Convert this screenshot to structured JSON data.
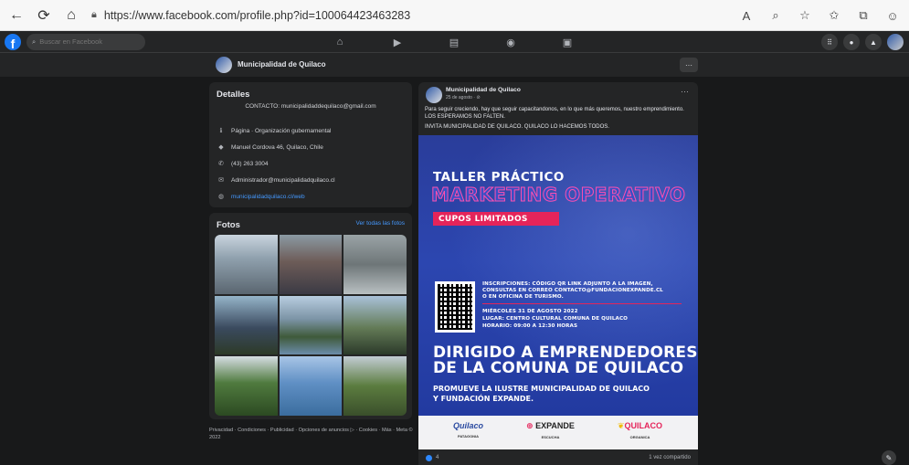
{
  "browser": {
    "url": "https://www.facebook.com/profile.php?id=100064423463283"
  },
  "fb_nav": {
    "search_placeholder": "Buscar en Facebook"
  },
  "page": {
    "name": "Municipalidad de Quilaco"
  },
  "details": {
    "title": "Detalles",
    "contact": "CONTACTO: municipalidaddequilaco@gmail.com",
    "category": "Página · Organización gubernamental",
    "address": "Manuel Cordova 46, Quilaco, Chile",
    "phone": "(43) 263 3004",
    "email": "Administrador@municipalidadquilaco.cl",
    "website": "municipalidadquilaco.cl/web"
  },
  "photos": {
    "title": "Fotos",
    "see_all": "Ver todas las fotos"
  },
  "footer": {
    "links": "Privacidad · Condiciones · Publicidad · Opciones de anuncios ▷ · Cookies · Más · Meta © 2022"
  },
  "post": {
    "author": "Municipalidad de Quilaco",
    "date": "25 de agosto · ⊘",
    "text1": "Para seguir creciendo, hay que seguir capacitandonos, en lo que más queremos, nuestro emprendimiento. LOS ESPERAMOS NO FALTEN.",
    "text2": "INVITA MUNICIPALIDAD DE QUILACO. QUILACO LO HACEMOS TODOS.",
    "likes": "4",
    "shares": "1 vez compartido"
  },
  "poster": {
    "title1": "TALLER PRÁCTICO",
    "title2": "MARKETING OPERATIVO",
    "cupos": "CUPOS LIMITADOS",
    "info1": "INSCRIPCIONES: CÓDIGO QR LINK ADJUNTO A LA IMAGEN,",
    "info2": "CONSULTAS EN CORREO CONTACTO@FUNDACIONEXPANDE.CL",
    "info3": "O EN OFICINA DE TURISMO.",
    "date": "MIÉRCOLES 31 DE AGOSTO 2022",
    "place": "LUGAR: CENTRO CULTURAL COMUNA DE QUILACO",
    "hours": "HORARIO: 09:00 A 12:30 HORAS",
    "dirigido1": "DIRIGIDO A EMPRENDEDORES",
    "dirigido2": "DE LA COMUNA DE QUILACO",
    "promueve1": "PROMUEVE LA ILUSTRE MUNICIPALIDAD DE QUILACO",
    "promueve2": "Y FUNDACIÓN EXPANDE.",
    "logo1": "Quilaco",
    "logo1_sub": "PATAGONIA",
    "logo2": "EXPANDE",
    "logo2_sub": "ESCUCHA",
    "logo3": "QUILACO",
    "logo3_sub": "ORGANICA"
  },
  "colors": {
    "fb_blue": "#1877f2",
    "link_blue": "#4599ff",
    "poster_blue": "#2c46b0",
    "poster_pink": "#e5245a"
  }
}
